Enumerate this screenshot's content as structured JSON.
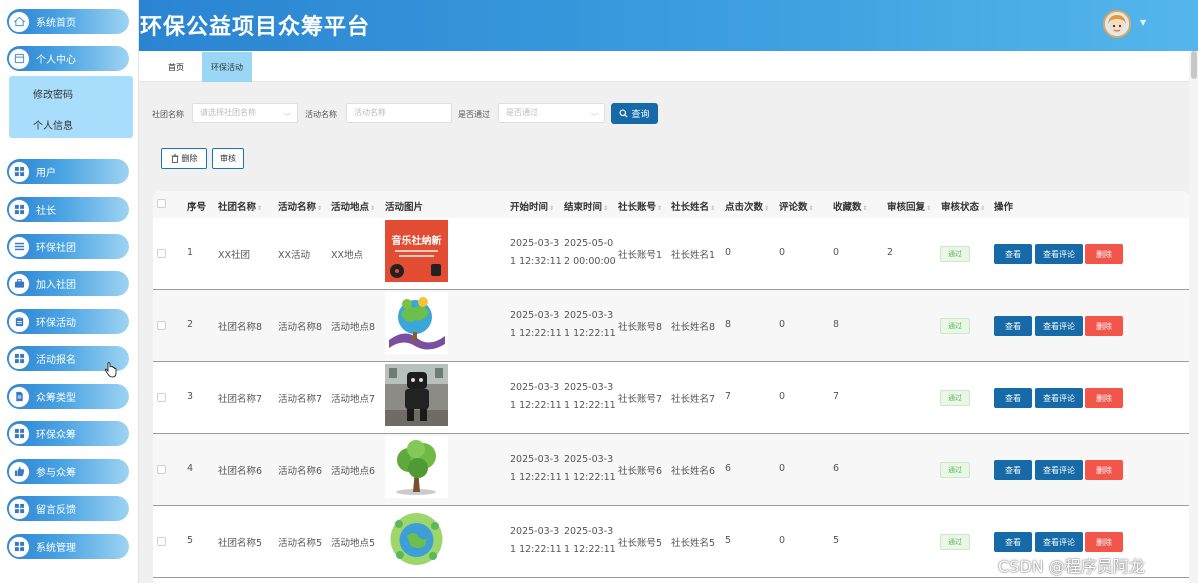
{
  "app": {
    "title": "环保公益项目众筹平台"
  },
  "sidebar": {
    "items": [
      {
        "label": "系统首页",
        "icon": "home-icon"
      },
      {
        "label": "个人中心",
        "icon": "window-icon"
      },
      {
        "label": "用户",
        "icon": "grid-icon"
      },
      {
        "label": "社长",
        "icon": "grid-icon"
      },
      {
        "label": "环保社团",
        "icon": "list-icon"
      },
      {
        "label": "加入社团",
        "icon": "briefcase-icon"
      },
      {
        "label": "环保活动",
        "icon": "clipboard-icon"
      },
      {
        "label": "活动报名",
        "icon": "grid-icon"
      },
      {
        "label": "众筹类型",
        "icon": "document-icon"
      },
      {
        "label": "环保众筹",
        "icon": "grid-icon"
      },
      {
        "label": "参与众筹",
        "icon": "thumbs-up-icon"
      },
      {
        "label": "留言反馈",
        "icon": "grid-icon"
      },
      {
        "label": "系统管理",
        "icon": "grid-icon"
      }
    ],
    "submenu": [
      {
        "label": "修改密码"
      },
      {
        "label": "个人信息"
      }
    ]
  },
  "tabs": [
    {
      "label": "首页"
    },
    {
      "label": "环保活动"
    }
  ],
  "filters": {
    "club_label": "社团名称",
    "club_placeholder": "请选择社团名称",
    "activity_label": "活动名称",
    "activity_placeholder": "活动名称",
    "passed_label": "是否通过",
    "passed_placeholder": "是否通过",
    "search_label": "查询"
  },
  "toolbar": {
    "delete_label": "删除",
    "review_label": "审核"
  },
  "table": {
    "headers": [
      "序号",
      "社团名称",
      "活动名称",
      "活动地点",
      "活动图片",
      "开始时间",
      "结束时间",
      "社长账号",
      "社长姓名",
      "点击次数",
      "评论数",
      "收藏数",
      "审核回复",
      "审核状态",
      "操作"
    ],
    "rows": [
      {
        "index": "1",
        "club": "XX社团",
        "activity": "XX活动",
        "place": "XX地点",
        "image": "music-club-poster",
        "start": [
          "2025-03-3",
          "1 12:32:11"
        ],
        "end": [
          "2025-05-0",
          "2 00:00:00"
        ],
        "account": "社长账号1",
        "name": "社长姓名1",
        "clicks": "0",
        "comments": "0",
        "favorites": "0",
        "reply": "2",
        "status": "通过"
      },
      {
        "index": "2",
        "club": "社团名称8",
        "activity": "活动名称8",
        "place": "活动地点8",
        "image": "earth-tree-illustration",
        "start": [
          "2025-03-3",
          "1 12:22:11"
        ],
        "end": [
          "2025-03-3",
          "1 12:22:11"
        ],
        "account": "社长账号8",
        "name": "社长姓名8",
        "clicks": "8",
        "comments": "0",
        "favorites": "8",
        "reply": "",
        "status": "通过"
      },
      {
        "index": "3",
        "club": "社团名称7",
        "activity": "活动名称7",
        "place": "活动地点7",
        "image": "mascot-photo",
        "start": [
          "2025-03-3",
          "1 12:22:11"
        ],
        "end": [
          "2025-03-3",
          "1 12:22:11"
        ],
        "account": "社长账号7",
        "name": "社长姓名7",
        "clicks": "7",
        "comments": "0",
        "favorites": "7",
        "reply": "",
        "status": "通过"
      },
      {
        "index": "4",
        "club": "社团名称6",
        "activity": "活动名称6",
        "place": "活动地点6",
        "image": "tree-illustration",
        "start": [
          "2025-03-3",
          "1 12:22:11"
        ],
        "end": [
          "2025-03-3",
          "1 12:22:11"
        ],
        "account": "社长账号6",
        "name": "社长姓名6",
        "clicks": "6",
        "comments": "0",
        "favorites": "6",
        "reply": "",
        "status": "通过"
      },
      {
        "index": "5",
        "club": "社团名称5",
        "activity": "活动名称5",
        "place": "活动地点5",
        "image": "green-earth-illustration",
        "start": [
          "2025-03-3",
          "1 12:22:11"
        ],
        "end": [
          "2025-03-3",
          "1 12:22:11"
        ],
        "account": "社长账号5",
        "name": "社长姓名5",
        "clicks": "5",
        "comments": "0",
        "favorites": "5",
        "reply": "",
        "status": "通过"
      }
    ],
    "actions": {
      "view": "查看",
      "comment": "查看评论",
      "delete": "删除"
    }
  },
  "image_texts": {
    "music_poster_title": "音乐社纳新"
  },
  "watermark": "CSDN @程序员阿龙",
  "colors": {
    "primary": "#166aa8",
    "header": "#2a84d2",
    "danger": "#f2564a",
    "success": "#5db75f",
    "submenu": "#a9ddfc"
  }
}
